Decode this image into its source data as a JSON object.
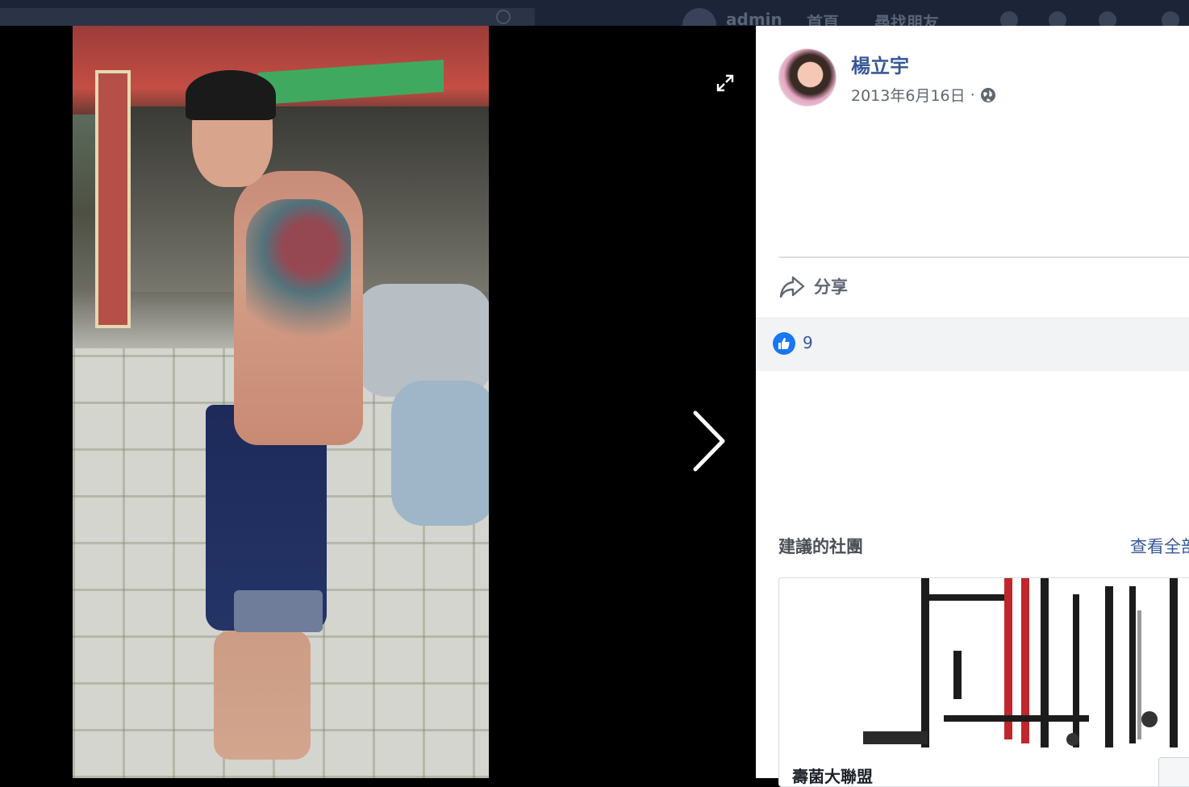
{
  "topbar": {
    "user_name": "admin",
    "nav_home": "首頁",
    "nav_find_friends": "尋找朋友"
  },
  "post": {
    "author": "楊立宇",
    "date": "2013年6月16日",
    "separator": "·",
    "privacy_icon": "globe-icon",
    "share_label": "分享",
    "like_count": "9"
  },
  "sidebar": {
    "suggested_groups_title": "建議的社團",
    "see_all_label": "查看全部",
    "group_name": "壽菌大聯盟"
  },
  "colors": {
    "link_blue": "#385898",
    "like_blue": "#1877f2",
    "panel_bg": "#ffffff",
    "reaction_bg": "#f2f3f5"
  }
}
